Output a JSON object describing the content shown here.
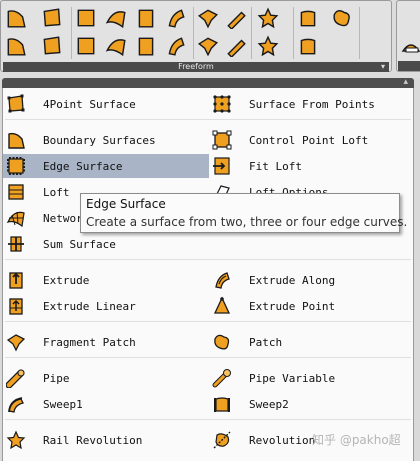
{
  "toolbar": {
    "panel_label": "Freeform",
    "dropdown_glyph": "▾",
    "icons": [
      "4point-surface-icon",
      "boundary-icon",
      "edge-surface-icon",
      "fit-loft-icon",
      "network-icon",
      "extrude-icon",
      "extrude-along-icon",
      "fragment-patch-icon",
      "pipe-icon",
      "rail-revolution-icon",
      "surface-from-points-icon",
      "sum-surface-icon",
      "control-point-loft-icon",
      "loft-options-icon",
      "loft-icon",
      "extrude-linear-icon",
      "extrude-point-icon",
      "patch-icon",
      "sweep1-icon",
      "sweep2-icon",
      "revolution-icon"
    ]
  },
  "menu": {
    "header_caret": "▴",
    "left": [
      {
        "label": "4Point Surface",
        "icon": "4point-surface-icon"
      },
      {
        "label": "Boundary Surfaces",
        "icon": "boundary-surfaces-icon"
      },
      {
        "label": "Edge Surface",
        "icon": "edge-surface-icon",
        "highlighted": true
      },
      {
        "label": "Loft",
        "icon": "loft-icon"
      },
      {
        "label": "Network Surface",
        "icon": "network-surface-icon"
      },
      {
        "label": "Sum Surface",
        "icon": "sum-surface-icon"
      },
      {
        "label": "Extrude",
        "icon": "extrude-icon"
      },
      {
        "label": "Extrude Linear",
        "icon": "extrude-linear-icon"
      },
      {
        "label": "Fragment Patch",
        "icon": "fragment-patch-icon"
      },
      {
        "label": "Pipe",
        "icon": "pipe-icon"
      },
      {
        "label": "Sweep1",
        "icon": "sweep1-icon"
      },
      {
        "label": "Rail Revolution",
        "icon": "rail-revolution-icon"
      }
    ],
    "right": [
      {
        "label": "Surface From Points",
        "icon": "surface-from-points-icon"
      },
      {
        "label": "Control Point Loft",
        "icon": "control-point-loft-icon"
      },
      {
        "label": "Fit Loft",
        "icon": "fit-loft-icon"
      },
      {
        "label": "Loft Options",
        "icon": "loft-options-icon"
      },
      {
        "label": "Extrude Along",
        "icon": "extrude-along-icon"
      },
      {
        "label": "Extrude Point",
        "icon": "extrude-point-icon"
      },
      {
        "label": "Patch",
        "icon": "patch-icon"
      },
      {
        "label": "Pipe Variable",
        "icon": "pipe-variable-icon"
      },
      {
        "label": "Sweep2",
        "icon": "sweep2-icon"
      },
      {
        "label": "Revolution",
        "icon": "revolution-icon"
      }
    ]
  },
  "tooltip": {
    "title": "Edge Surface",
    "description": "Create a surface from two, three or four edge curves."
  },
  "watermark": "知乎 @pakho超",
  "colors": {
    "icon_orange": "#f0a020",
    "icon_dark": "#1a1a1a",
    "highlight": "#a9b4c6",
    "panel_label_bg": "#4a4a4a"
  }
}
